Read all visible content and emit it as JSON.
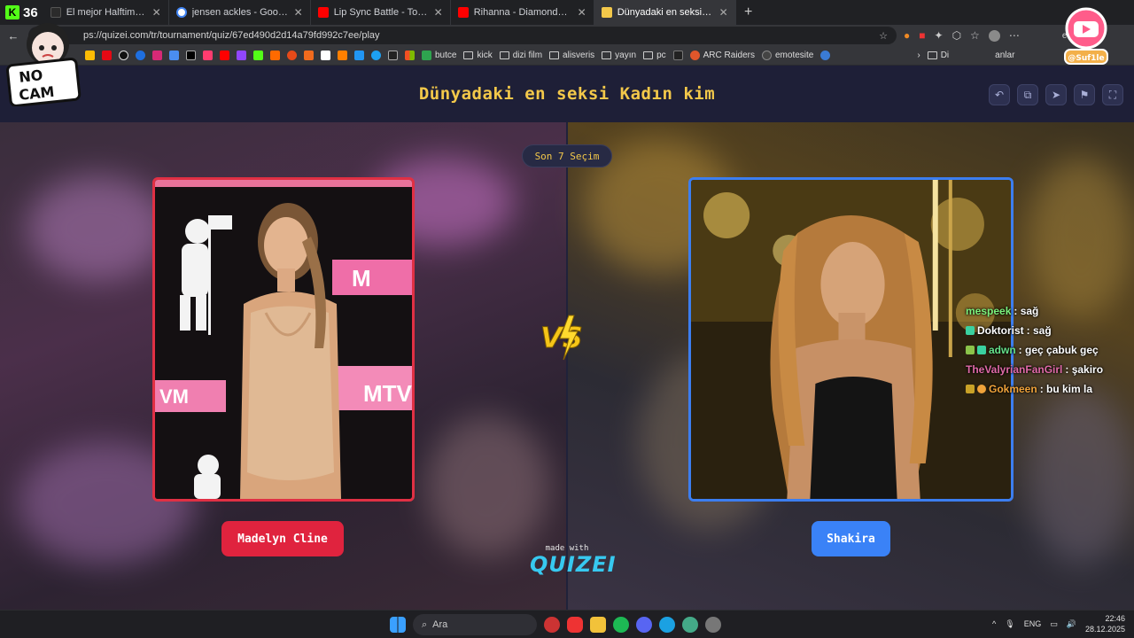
{
  "browser": {
    "kick_count": "36",
    "tabs": [
      {
        "title": "El mejor Halftime Show Super Bow",
        "color": "#2b2b2b",
        "active": false
      },
      {
        "title": "jensen ackles - Google'da Ara",
        "color": "#4285f4",
        "active": false
      },
      {
        "title": "Lip Sync Battle - Tom Holland - Yo",
        "color": "#ff0000",
        "active": false
      },
      {
        "title": "Rihanna - Diamonds Live Victoria's",
        "color": "#ff0000",
        "active": false
      },
      {
        "title": "Dünyadaki en seksi Kadın kim - Te",
        "color": "#f3c84a",
        "active": true
      }
    ],
    "new_tab": "+",
    "url": "ps://quizei.com/tr/tournament/quiz/67ed490d2d14a79fd992c7ee/play",
    "profile_label": "et",
    "bookmarks": [
      "butce",
      "kick",
      "dizi film",
      "alisveris",
      "yayın",
      "pc",
      "ARC Raiders",
      "emotesite"
    ],
    "bookmarks_right": "Di",
    "bookmarks_right2": "anlar"
  },
  "quiz": {
    "title": "Dünyadaki en seksi Kadın kim",
    "round_label": "Son 7 Seçim",
    "left_name": "Madelyn Cline",
    "right_name": "Shakira",
    "vs_text": "VS",
    "made_with": "made with",
    "brand": "QUIZEI",
    "header_icons": [
      "undo-icon",
      "share-icon",
      "send-icon",
      "flag-icon",
      "fullscreen-icon"
    ]
  },
  "overlays": {
    "nocam_line1": "NO",
    "nocam_line2": "CAM",
    "yt_handle": "@Suf1le"
  },
  "chat": [
    {
      "user": "mespeek",
      "msg": ": sağ",
      "color": "#7cf27c"
    },
    {
      "user": "Doktorist",
      "msg": ": sağ",
      "color": "#ffffff"
    },
    {
      "user": "adwn",
      "msg": ": geç çabuk geç",
      "color": "#66e28a"
    },
    {
      "user": "TheValyrianFanGirl",
      "msg": ": şakiro",
      "color": "#e06aa8"
    },
    {
      "user": "Gokmeen",
      "msg": ": bu kim la",
      "color": "#f0a33a"
    }
  ],
  "taskbar": {
    "search_placeholder": "Ara",
    "lang": "ENG",
    "time": "22:46",
    "date": "28.12.2025"
  }
}
